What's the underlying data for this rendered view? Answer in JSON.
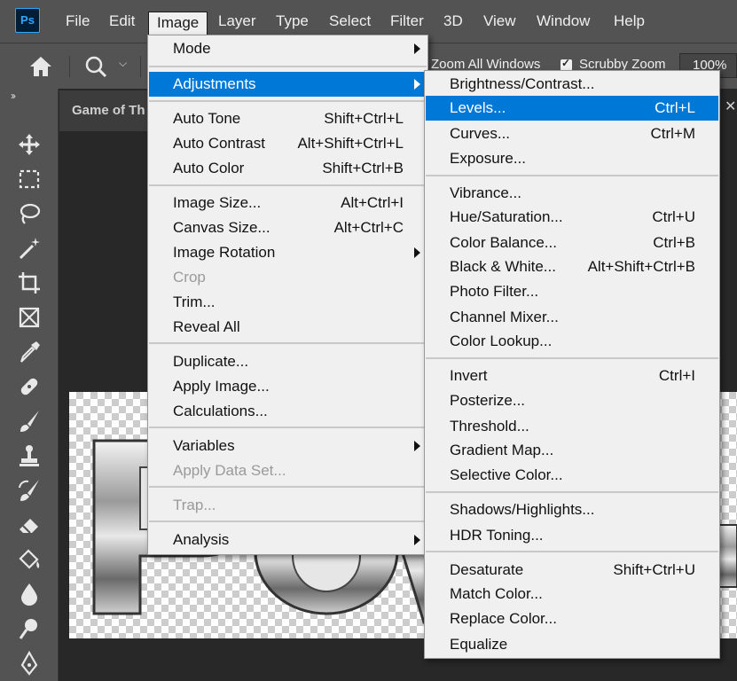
{
  "app": {
    "logo_text": "Ps"
  },
  "menubar": {
    "items": [
      {
        "label": "File"
      },
      {
        "label": "Edit"
      },
      {
        "label": "Image"
      },
      {
        "label": "Layer"
      },
      {
        "label": "Type"
      },
      {
        "label": "Select"
      },
      {
        "label": "Filter"
      },
      {
        "label": "3D"
      },
      {
        "label": "View"
      },
      {
        "label": "Window"
      },
      {
        "label": "Help"
      }
    ],
    "active": "Image"
  },
  "options_bar": {
    "zoom_all_windows": {
      "label": "Zoom All Windows",
      "checked": true
    },
    "scrubby_zoom": {
      "label": "Scrubby Zoom",
      "checked": true
    },
    "zoom_value": "100%"
  },
  "document": {
    "tab_title": "Game of Th"
  },
  "image_menu": {
    "items": [
      {
        "label": "Mode",
        "shortcut": "",
        "submenu": true
      },
      {
        "label": "Adjustments",
        "shortcut": "",
        "submenu": true,
        "highlighted": true
      },
      {
        "label": "Auto Tone",
        "shortcut": "Shift+Ctrl+L"
      },
      {
        "label": "Auto Contrast",
        "shortcut": "Alt+Shift+Ctrl+L"
      },
      {
        "label": "Auto Color",
        "shortcut": "Shift+Ctrl+B"
      },
      {
        "label": "Image Size...",
        "shortcut": "Alt+Ctrl+I"
      },
      {
        "label": "Canvas Size...",
        "shortcut": "Alt+Ctrl+C"
      },
      {
        "label": "Image Rotation",
        "shortcut": "",
        "submenu": true
      },
      {
        "label": "Crop",
        "shortcut": "",
        "disabled": true
      },
      {
        "label": "Trim...",
        "shortcut": ""
      },
      {
        "label": "Reveal All",
        "shortcut": ""
      },
      {
        "label": "Duplicate...",
        "shortcut": ""
      },
      {
        "label": "Apply Image...",
        "shortcut": ""
      },
      {
        "label": "Calculations...",
        "shortcut": ""
      },
      {
        "label": "Variables",
        "shortcut": "",
        "submenu": true
      },
      {
        "label": "Apply Data Set...",
        "shortcut": "",
        "disabled": true
      },
      {
        "label": "Trap...",
        "shortcut": "",
        "disabled": true
      },
      {
        "label": "Analysis",
        "shortcut": "",
        "submenu": true
      }
    ]
  },
  "adjustments_menu": {
    "items": [
      {
        "label": "Brightness/Contrast...",
        "shortcut": ""
      },
      {
        "label": "Levels...",
        "shortcut": "Ctrl+L",
        "highlighted": true
      },
      {
        "label": "Curves...",
        "shortcut": "Ctrl+M"
      },
      {
        "label": "Exposure...",
        "shortcut": ""
      },
      {
        "label": "Vibrance...",
        "shortcut": ""
      },
      {
        "label": "Hue/Saturation...",
        "shortcut": "Ctrl+U"
      },
      {
        "label": "Color Balance...",
        "shortcut": "Ctrl+B"
      },
      {
        "label": "Black & White...",
        "shortcut": "Alt+Shift+Ctrl+B"
      },
      {
        "label": "Photo Filter...",
        "shortcut": ""
      },
      {
        "label": "Channel Mixer...",
        "shortcut": ""
      },
      {
        "label": "Color Lookup...",
        "shortcut": ""
      },
      {
        "label": "Invert",
        "shortcut": "Ctrl+I"
      },
      {
        "label": "Posterize...",
        "shortcut": ""
      },
      {
        "label": "Threshold...",
        "shortcut": ""
      },
      {
        "label": "Gradient Map...",
        "shortcut": ""
      },
      {
        "label": "Selective Color...",
        "shortcut": ""
      },
      {
        "label": "Shadows/Highlights...",
        "shortcut": ""
      },
      {
        "label": "HDR Toning...",
        "shortcut": ""
      },
      {
        "label": "Desaturate",
        "shortcut": "Shift+Ctrl+U"
      },
      {
        "label": "Match Color...",
        "shortcut": ""
      },
      {
        "label": "Replace Color...",
        "shortcut": ""
      },
      {
        "label": "Equalize",
        "shortcut": ""
      }
    ]
  },
  "toolbar": {
    "tools": [
      "move-tool-icon",
      "marquee-tool-icon",
      "lasso-tool-icon",
      "magic-wand-tool-icon",
      "crop-tool-icon",
      "frame-tool-icon",
      "eyedropper-tool-icon",
      "healing-brush-tool-icon",
      "brush-tool-icon",
      "clone-stamp-tool-icon",
      "history-brush-tool-icon",
      "eraser-tool-icon",
      "paint-bucket-tool-icon",
      "blur-tool-icon",
      "dodge-tool-icon",
      "pen-tool-icon"
    ]
  },
  "colors": {
    "highlight": "#0078d7",
    "menu_bg": "#f0f0f0",
    "chrome": "#535353",
    "workspace": "#282828"
  }
}
